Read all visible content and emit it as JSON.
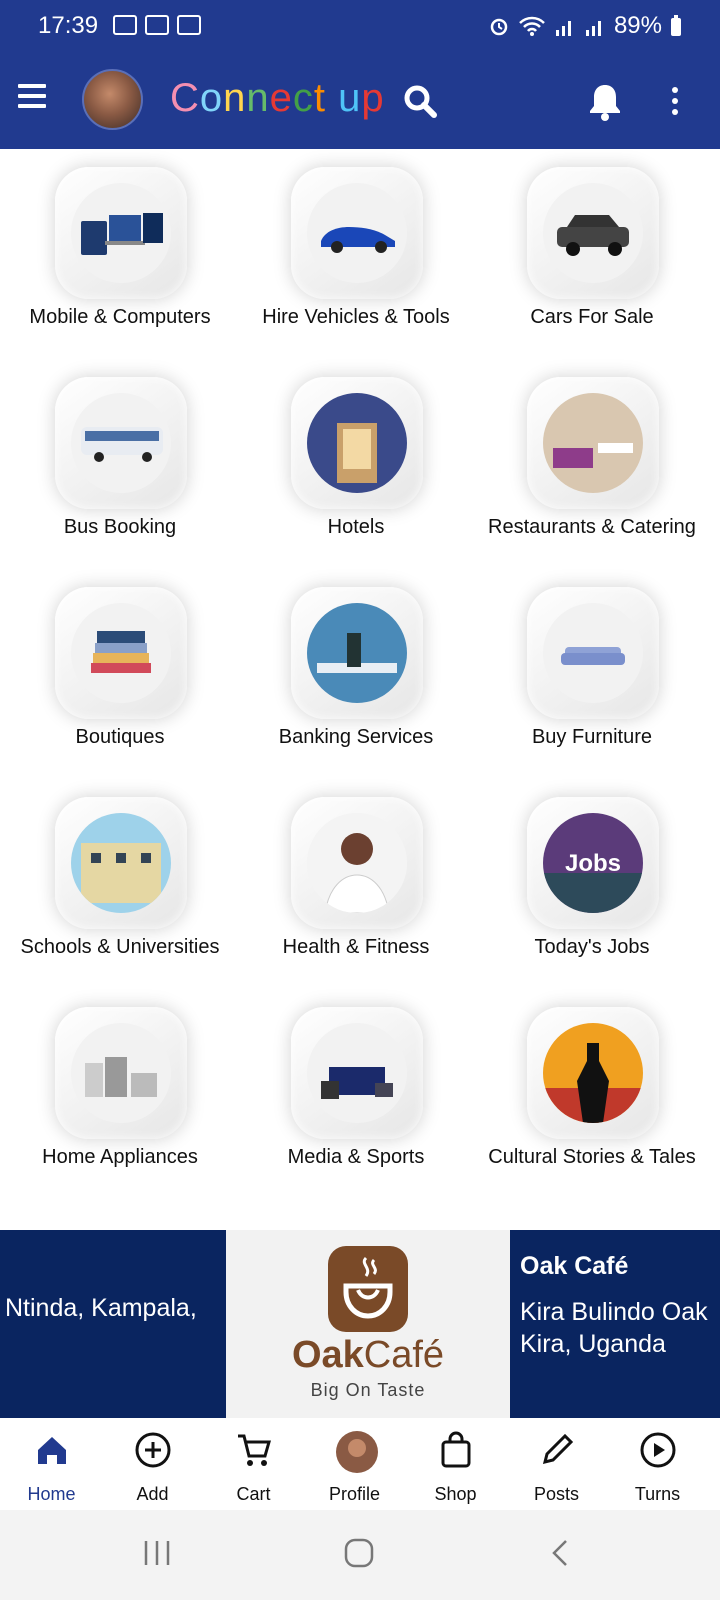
{
  "status": {
    "time": "17:39",
    "battery": "89%"
  },
  "header": {
    "brand_letters": [
      {
        "ch": "C",
        "color": "#f48fb1"
      },
      {
        "ch": "o",
        "color": "#81d4fa"
      },
      {
        "ch": "n",
        "color": "#ffd54f"
      },
      {
        "ch": "n",
        "color": "#66bb6a"
      },
      {
        "ch": "e",
        "color": "#e53935"
      },
      {
        "ch": "c",
        "color": "#43a047"
      },
      {
        "ch": "t",
        "color": "#fb8c00"
      },
      {
        "ch": " ",
        "color": "#ffffff"
      },
      {
        "ch": "u",
        "color": "#4fc3f7"
      },
      {
        "ch": "p",
        "color": "#e53935"
      }
    ],
    "brand": "Connect up",
    "icons": [
      "menu-icon",
      "search-icon",
      "bell-icon",
      "more-vert-icon"
    ]
  },
  "categories": [
    {
      "label": "Mobile & Computers",
      "icon": "devices-icon"
    },
    {
      "label": "Hire Vehicles & Tools",
      "icon": "car-icon"
    },
    {
      "label": "Cars For Sale",
      "icon": "suv-icon"
    },
    {
      "label": "Bus Booking",
      "icon": "bus-icon"
    },
    {
      "label": "Hotels",
      "icon": "hotel-icon"
    },
    {
      "label": "Restaurants & Catering",
      "icon": "restaurant-icon"
    },
    {
      "label": "Boutiques",
      "icon": "clothes-icon"
    },
    {
      "label": "Banking Services",
      "icon": "bank-icon"
    },
    {
      "label": "Buy Furniture",
      "icon": "sofa-icon"
    },
    {
      "label": "Schools & Universities",
      "icon": "school-icon"
    },
    {
      "label": "Health & Fitness",
      "icon": "doctor-icon"
    },
    {
      "label": "Today's Jobs",
      "icon": "jobs-icon",
      "image_text": "Jobs"
    },
    {
      "label": "Home Appliances",
      "icon": "appliances-icon"
    },
    {
      "label": "Media & Sports",
      "icon": "media-icon"
    },
    {
      "label": "Cultural Stories & Tales",
      "icon": "culture-icon"
    }
  ],
  "ad": {
    "left_text": "Ntinda, Kampala,",
    "logo_bold": "Oak",
    "logo_light": "Café",
    "tagline": "Big On Taste",
    "right_title": "Oak Café",
    "right_address_line1": "Kira Bulindo Oak",
    "right_address_line2": "Kira, Uganda"
  },
  "bottom_nav": [
    {
      "label": "Home",
      "icon": "home-icon",
      "active": true
    },
    {
      "label": "Add",
      "icon": "add-circle-icon",
      "active": false
    },
    {
      "label": "Cart",
      "icon": "cart-icon",
      "active": false
    },
    {
      "label": "Profile",
      "icon": "avatar",
      "active": false
    },
    {
      "label": "Shop",
      "icon": "shopping-bag-icon",
      "active": false
    },
    {
      "label": "Posts",
      "icon": "pencil-icon",
      "active": false
    },
    {
      "label": "Turns",
      "icon": "play-circle-icon",
      "active": false
    }
  ],
  "colors": {
    "primary": "#213a8f",
    "ad_bg": "#0a2560",
    "brown": "#7a4a28"
  }
}
